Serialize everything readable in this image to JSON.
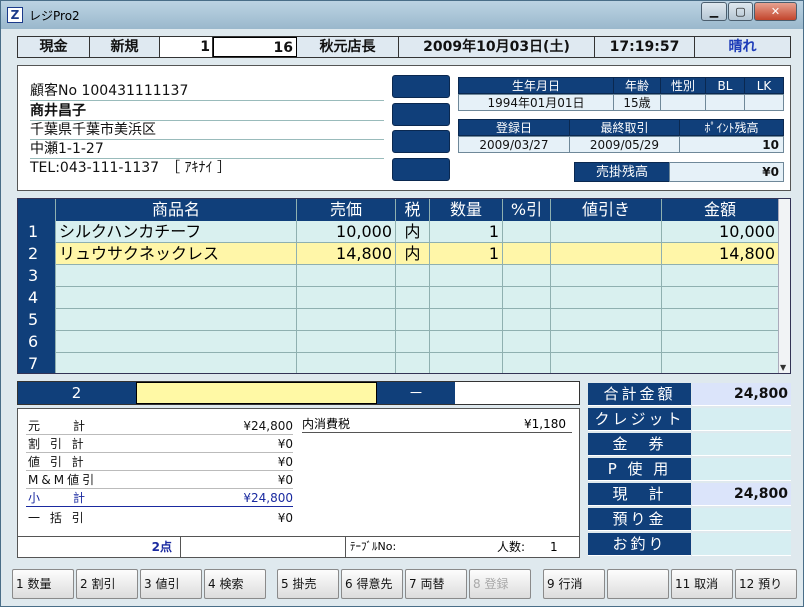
{
  "window": {
    "title": "レジPro2",
    "logo_glyph": "Z"
  },
  "status": {
    "mode": "現金",
    "type": "新規",
    "num1": "1",
    "num2": "16",
    "clerk": "秋元店長",
    "date": "2009年10月03日(土)",
    "time": "17:19:57",
    "weather": "晴れ"
  },
  "customer": {
    "no_line": "顧客No 100431111137",
    "name": "商井昌子",
    "address1": "千葉県千葉市美浜区",
    "address2": "中瀬1-1-27",
    "tel_line": "TEL:043-111-1137　［ ｱｷﾅｲ ］"
  },
  "info": {
    "birthday_label": "生年月日",
    "birthday": "1994年01月01日",
    "age_label": "年齢",
    "age": "15歳",
    "gender_label": "性別",
    "gender": "",
    "bl_label": "BL",
    "bl": "",
    "lk_label": "LK",
    "lk": "",
    "reg_label": "登録日",
    "reg": "2009/03/27",
    "last_label": "最終取引",
    "last": "2009/05/29",
    "points_label": "ﾎﾟｲﾝﾄ残高",
    "points": "10",
    "credit_label": "売掛残高",
    "credit": "¥0"
  },
  "table": {
    "headers": {
      "name": "商品名",
      "price": "売価",
      "tax": "税",
      "qty": "数量",
      "pct": "%引",
      "disc": "値引き",
      "amount": "金額"
    },
    "rows": [
      {
        "n": "1",
        "name": "シルクハンカチーフ",
        "price": "10,000",
        "tax": "内",
        "qty": "1",
        "pct": "",
        "disc": "",
        "amount": "10,000"
      },
      {
        "n": "2",
        "name": "リュウサクネックレス",
        "price": "14,800",
        "tax": "内",
        "qty": "1",
        "pct": "",
        "disc": "",
        "amount": "14,800"
      },
      {
        "n": "3",
        "name": "",
        "price": "",
        "tax": "",
        "qty": "",
        "pct": "",
        "disc": "",
        "amount": ""
      },
      {
        "n": "4",
        "name": "",
        "price": "",
        "tax": "",
        "qty": "",
        "pct": "",
        "disc": "",
        "amount": ""
      },
      {
        "n": "5",
        "name": "",
        "price": "",
        "tax": "",
        "qty": "",
        "pct": "",
        "disc": "",
        "amount": ""
      },
      {
        "n": "6",
        "name": "",
        "price": "",
        "tax": "",
        "qty": "",
        "pct": "",
        "disc": "",
        "amount": ""
      },
      {
        "n": "7",
        "name": "",
        "price": "",
        "tax": "",
        "qty": "",
        "pct": "",
        "disc": "",
        "amount": ""
      }
    ]
  },
  "entry": {
    "row": "2",
    "code": "",
    "dash": "－",
    "qty": ""
  },
  "totals": {
    "gross_label": "元　　計",
    "gross": "¥24,800",
    "waribiki_label": "割 引 計",
    "waribiki": "¥0",
    "nebiki_label": "値 引 計",
    "nebiki": "¥0",
    "mm_label": "M&M値引",
    "mm": "¥0",
    "subtotal_label": "小　　計",
    "subtotal": "¥24,800",
    "bulk_label": "一 括 引",
    "bulk": "¥0",
    "tax_label": "内消費税",
    "tax": "¥1,180",
    "points_count": "2点",
    "table_label": "ﾃｰﾌﾞﾙNo:",
    "people_label": "人数:",
    "people": "1"
  },
  "summary": [
    {
      "label": "合計金額",
      "value": "24,800",
      "highlight": true
    },
    {
      "label": "クレジット",
      "value": "",
      "highlight": false
    },
    {
      "label": "金　券",
      "value": "",
      "highlight": false
    },
    {
      "label": "P 使 用",
      "value": "",
      "highlight": false
    },
    {
      "label": "現　計",
      "value": "24,800",
      "highlight": true
    },
    {
      "label": "預り金",
      "value": "",
      "highlight": false
    },
    {
      "label": "お釣り",
      "value": "",
      "highlight": false
    }
  ],
  "fkeys": [
    {
      "label": "1 数量",
      "enabled": true
    },
    {
      "label": "2 割引",
      "enabled": true
    },
    {
      "label": "3 値引",
      "enabled": true
    },
    {
      "label": "4 検索",
      "enabled": true
    },
    {
      "label": "5 掛売",
      "enabled": true
    },
    {
      "label": "6 得意先",
      "enabled": true
    },
    {
      "label": "7 両替",
      "enabled": true
    },
    {
      "label": "8 登録",
      "enabled": false
    },
    {
      "label": "9 行消",
      "enabled": true
    },
    {
      "label": "",
      "enabled": true
    },
    {
      "label": "11 取消",
      "enabled": true
    },
    {
      "label": "12 預り",
      "enabled": true
    }
  ],
  "colors": {
    "accent": "#103f7a",
    "highlight_row": "#fff6a8",
    "cell_bg": "#d9f0ef"
  }
}
